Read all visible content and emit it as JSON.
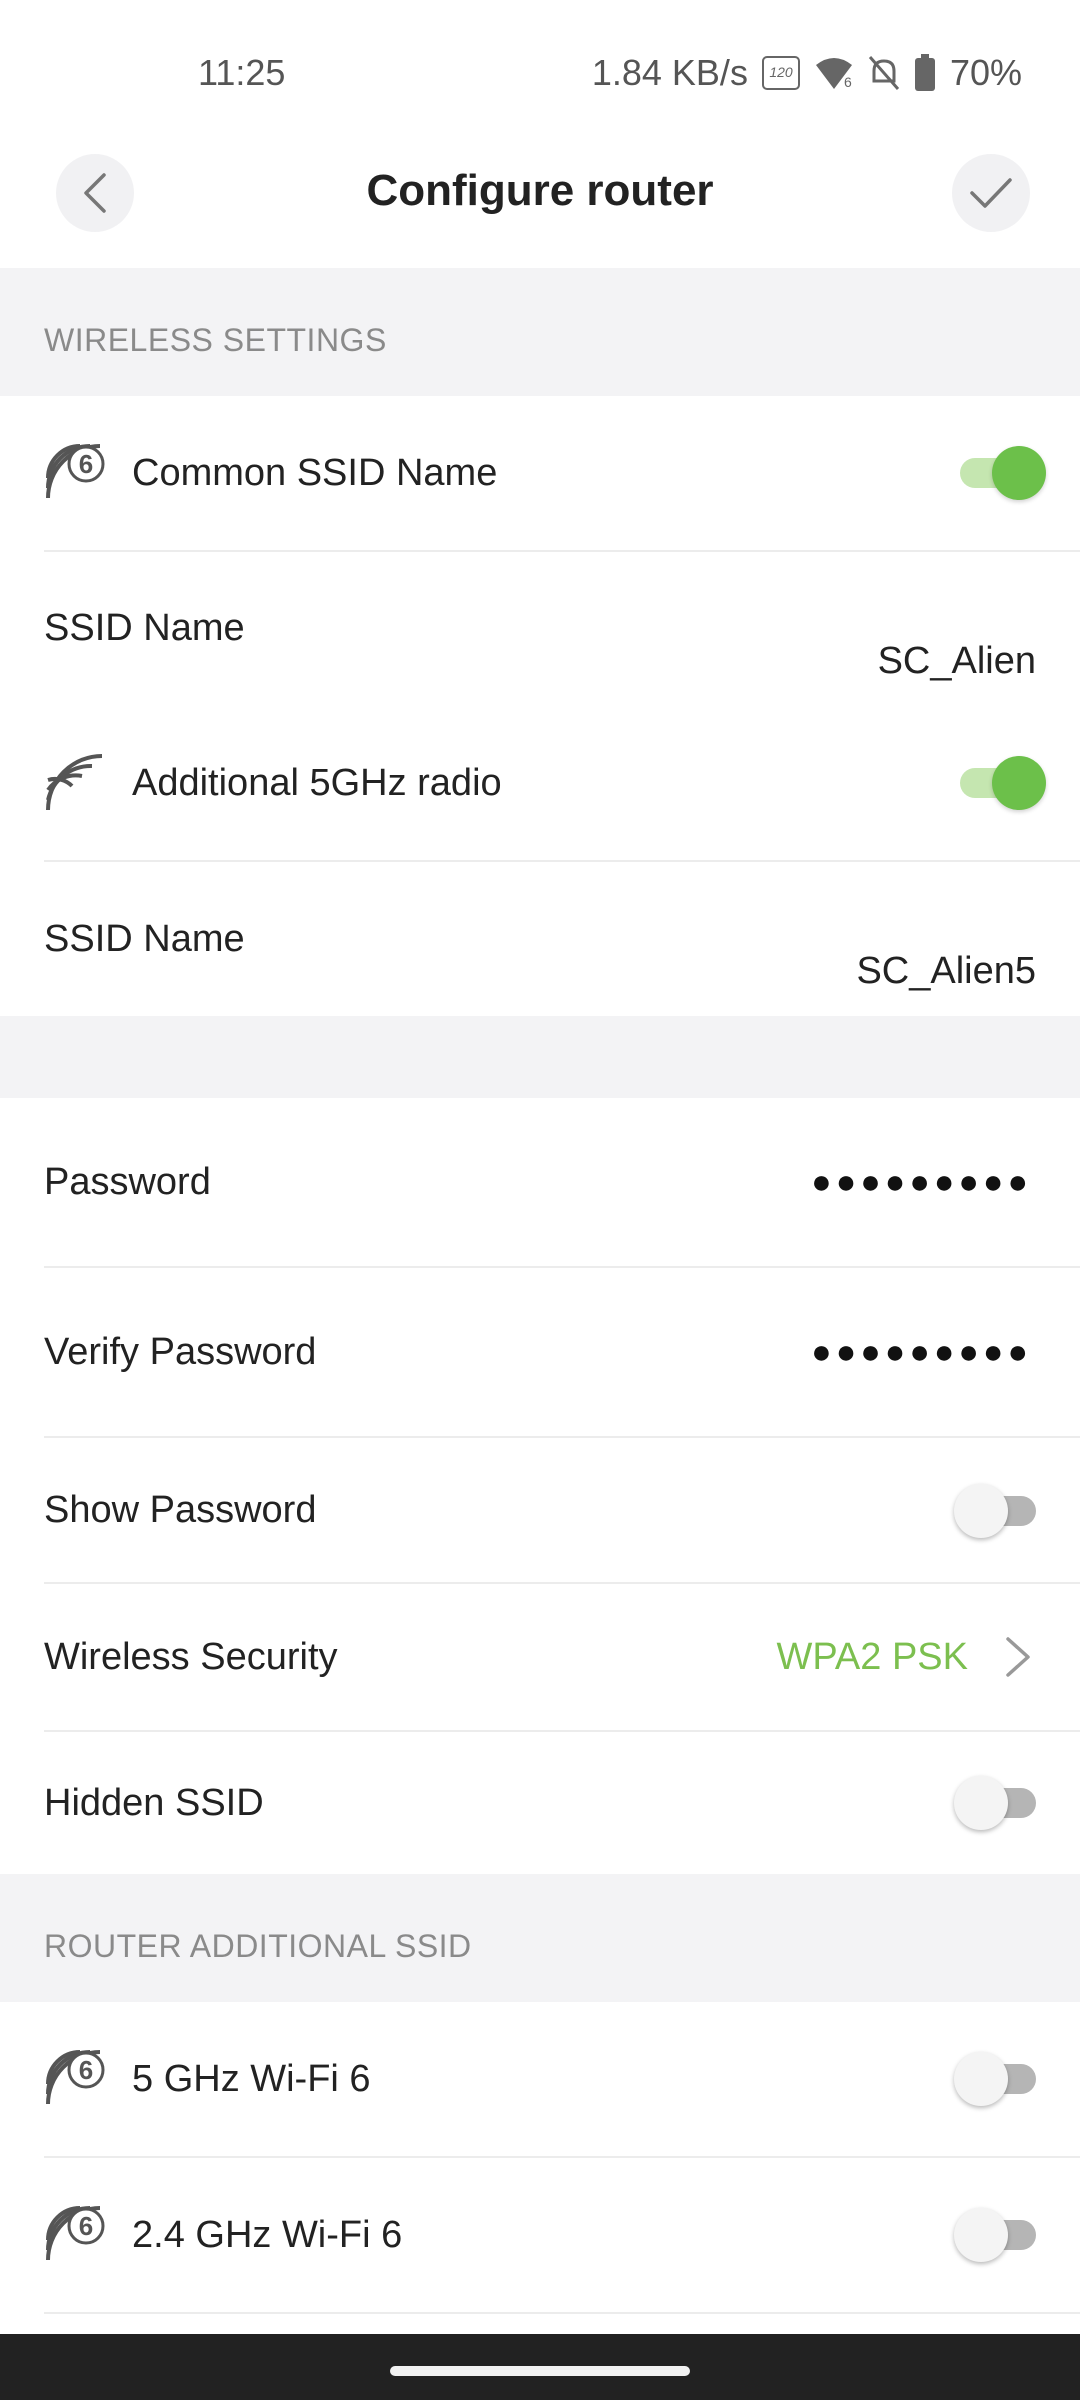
{
  "status": {
    "time": "11:25",
    "speed": "1.84 KB/s",
    "refresh_badge": "120",
    "battery": "70%"
  },
  "header": {
    "title": "Configure router"
  },
  "wireless": {
    "section_title": "WIRELESS SETTINGS",
    "common_ssid_label": "Common SSID Name",
    "common_ssid_on": true,
    "ssid_label": "SSID Name",
    "ssid_value": "SC_Alien",
    "additional_5g_label": "Additional 5GHz radio",
    "additional_5g_on": true,
    "ssid5_label": "SSID Name",
    "ssid5_value": "SC_Alien5"
  },
  "security": {
    "password_label": "Password",
    "password_value": "●●●●●●●●●",
    "verify_label": "Verify Password",
    "verify_value": "●●●●●●●●●",
    "show_password_label": "Show Password",
    "show_password_on": false,
    "wireless_security_label": "Wireless Security",
    "wireless_security_value": "WPA2 PSK",
    "hidden_ssid_label": "Hidden SSID",
    "hidden_ssid_on": false
  },
  "additional": {
    "section_title": "ROUTER ADDITIONAL SSID",
    "wifi6_5g_label": "5 GHz Wi-Fi 6",
    "wifi6_5g_on": false,
    "wifi6_24g_label": "2.4 GHz Wi-Fi 6",
    "wifi6_24g_on": false
  },
  "colors": {
    "accent_green": "#6cc04a",
    "link_green": "#7cbf4f",
    "section_bg": "#f3f3f5"
  }
}
